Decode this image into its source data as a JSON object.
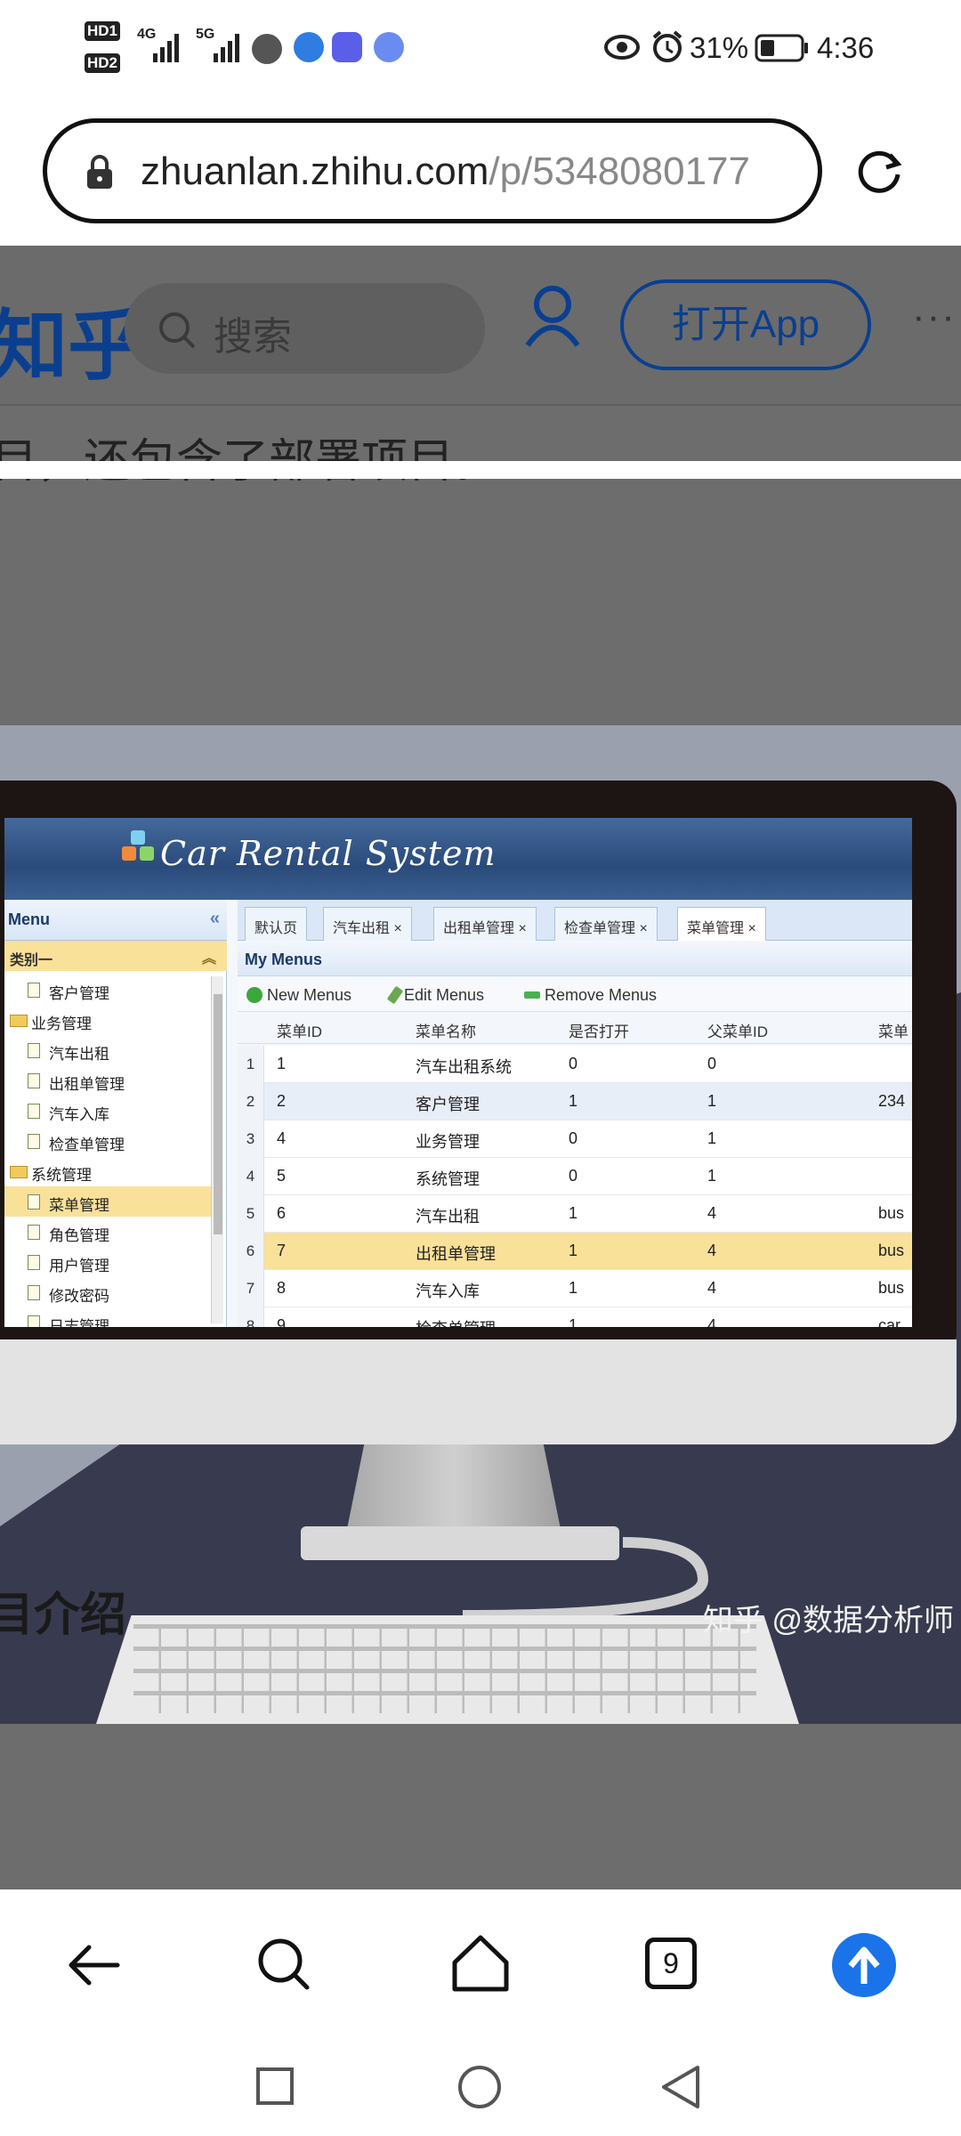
{
  "status_bar": {
    "hd1": "HD1",
    "hd2": "HD2",
    "net1": "4G",
    "net2": "5G",
    "battery_pct": "31%",
    "time": "4:36"
  },
  "browser": {
    "url_host": "zhuanlan.zhihu.com",
    "url_path": "/p/5348080177",
    "tab_count": "9"
  },
  "zhihu_header": {
    "logo": "知乎",
    "search_placeholder": "搜索",
    "open_app_label": "打开App"
  },
  "article": {
    "text_line": "目，还包含了部署项目。",
    "section_title": "目介绍",
    "image_watermark": "知乎 @数据分析师"
  },
  "app_screenshot": {
    "title": "Car Rental System",
    "menu_header": "Menu",
    "category": "类别一",
    "tree": [
      {
        "label": "客户管理",
        "level": 1,
        "type": "leaf"
      },
      {
        "label": "业务管理",
        "level": 0,
        "type": "folder"
      },
      {
        "label": "汽车出租",
        "level": 1,
        "type": "leaf"
      },
      {
        "label": "出租单管理",
        "level": 1,
        "type": "leaf"
      },
      {
        "label": "汽车入库",
        "level": 1,
        "type": "leaf"
      },
      {
        "label": "检查单管理",
        "level": 1,
        "type": "leaf"
      },
      {
        "label": "系统管理",
        "level": 0,
        "type": "folder"
      },
      {
        "label": "菜单管理",
        "level": 1,
        "type": "leaf",
        "selected": true
      },
      {
        "label": "角色管理",
        "level": 1,
        "type": "leaf"
      },
      {
        "label": "用户管理",
        "level": 1,
        "type": "leaf"
      },
      {
        "label": "修改密码",
        "level": 1,
        "type": "leaf"
      },
      {
        "label": "日志管理",
        "level": 1,
        "type": "leaf"
      }
    ],
    "tabs": [
      "默认页",
      "汽车出租 ×",
      "出租单管理 ×",
      "检查单管理 ×",
      "菜单管理 ×"
    ],
    "active_tab": 4,
    "grid_title": "My Menus",
    "toolbar": {
      "new": "New Menus",
      "edit": "Edit Menus",
      "remove": "Remove Menus"
    },
    "columns": [
      "菜单ID",
      "菜单名称",
      "是否打开",
      "父菜单ID",
      "菜单"
    ],
    "rows": [
      {
        "n": "1",
        "cells": [
          "1",
          "汽车出租系统",
          "0",
          "0",
          ""
        ]
      },
      {
        "n": "2",
        "cells": [
          "2",
          "客户管理",
          "1",
          "1",
          "234"
        ]
      },
      {
        "n": "3",
        "cells": [
          "4",
          "业务管理",
          "0",
          "1",
          ""
        ]
      },
      {
        "n": "4",
        "cells": [
          "5",
          "系统管理",
          "0",
          "1",
          ""
        ]
      },
      {
        "n": "5",
        "cells": [
          "6",
          "汽车出租",
          "1",
          "4",
          "bus"
        ]
      },
      {
        "n": "6",
        "cells": [
          "7",
          "出租单管理",
          "1",
          "4",
          "bus"
        ]
      },
      {
        "n": "7",
        "cells": [
          "8",
          "汽车入库",
          "1",
          "4",
          "bus"
        ]
      },
      {
        "n": "8",
        "cells": [
          "9",
          "检查单管理",
          "1",
          "4",
          "car"
        ]
      }
    ]
  },
  "colors": {
    "zhihu_blue": "#0a3f8f",
    "highlight_yellow": "#f9e19a",
    "upload_blue": "#1a73e8"
  }
}
